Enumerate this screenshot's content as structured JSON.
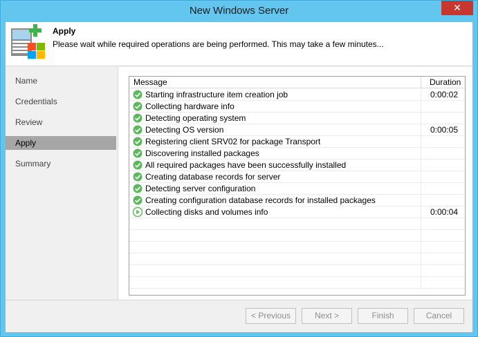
{
  "window": {
    "title": "New Windows Server",
    "close_glyph": "✕"
  },
  "header": {
    "title": "Apply",
    "description": "Please wait while required operations are being performed. This may take a few minutes...",
    "icon": "windows-server-add-icon"
  },
  "sidebar": {
    "items": [
      {
        "label": "Name"
      },
      {
        "label": "Credentials"
      },
      {
        "label": "Review"
      },
      {
        "label": "Apply"
      },
      {
        "label": "Summary"
      }
    ],
    "active_index": 3
  },
  "table": {
    "columns": {
      "message": "Message",
      "duration": "Duration"
    },
    "rows": [
      {
        "status": "success",
        "message": "Starting infrastructure item creation job",
        "duration": "0:00:02"
      },
      {
        "status": "success",
        "message": "Collecting hardware info",
        "duration": ""
      },
      {
        "status": "success",
        "message": "Detecting operating system",
        "duration": ""
      },
      {
        "status": "success",
        "message": "Detecting OS version",
        "duration": "0:00:05"
      },
      {
        "status": "success",
        "message": "Registering client SRV02 for package Transport",
        "duration": ""
      },
      {
        "status": "success",
        "message": "Discovering installed packages",
        "duration": ""
      },
      {
        "status": "success",
        "message": "All required packages have been successfully installed",
        "duration": ""
      },
      {
        "status": "success",
        "message": "Creating database records for server",
        "duration": ""
      },
      {
        "status": "success",
        "message": "Detecting server configuration",
        "duration": ""
      },
      {
        "status": "success",
        "message": "Creating configuration database records for installed packages",
        "duration": ""
      },
      {
        "status": "running",
        "message": "Collecting disks and volumes info",
        "duration": "0:00:04"
      }
    ],
    "empty_rows": 6
  },
  "footer": {
    "previous_label": "< Previous",
    "next_label": "Next >",
    "finish_label": "Finish",
    "cancel_label": "Cancel"
  },
  "colors": {
    "titlebar": "#63c6ee",
    "close": "#c7372f",
    "success": "#5cb85c",
    "running": "#5cb85c",
    "active_nav": "#a6a6a6"
  }
}
